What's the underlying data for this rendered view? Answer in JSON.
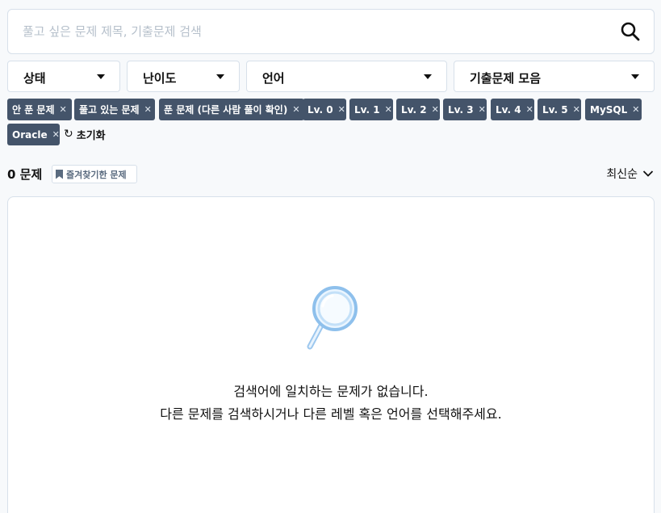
{
  "search": {
    "placeholder": "풀고 싶은 문제 제목, 기출문제 검색",
    "value": ""
  },
  "filters": [
    {
      "label": "상태"
    },
    {
      "label": "난이도"
    },
    {
      "label": "언어"
    },
    {
      "label": "기출문제 모음"
    }
  ],
  "tags": [
    "안 푼 문제",
    "풀고 있는 문제",
    "푼 문제 (다른 사람 풀이 확인)",
    "Lv. 0",
    "Lv. 1",
    "Lv. 2",
    "Lv. 3",
    "Lv. 4",
    "Lv. 5",
    "MySQL",
    "Oracle"
  ],
  "reset_label": "초기화",
  "count_label": "0 문제",
  "bookmark_label": "즐겨찾기한 문제",
  "sort_label": "최신순",
  "empty": {
    "line1": "검색어에 일치하는 문제가 없습니다.",
    "line2": "다른 문제를 검색하시거나 다른 레벨 혹은 언어를 선택해주세요."
  },
  "colors": {
    "tag_bg": "#44546a",
    "border": "#d7e0ea",
    "page_bg": "#f7f9fb"
  }
}
